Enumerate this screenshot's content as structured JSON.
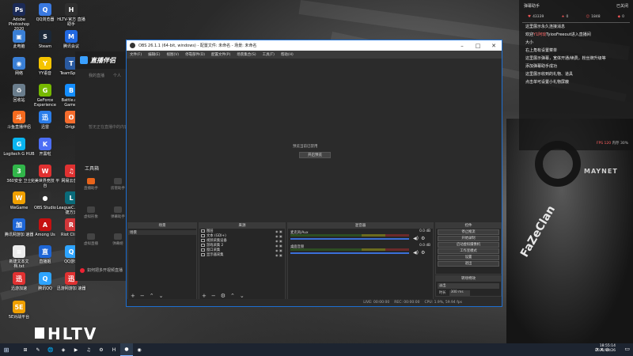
{
  "desktop": {
    "icons": [
      {
        "label": "Adobe\nPhotoshop 2020",
        "color": "#1b2a56",
        "glyph": "Ps"
      },
      {
        "label": "QQ浏览器",
        "color": "#3a79e0",
        "glyph": "Q"
      },
      {
        "label": "HLTV-官方\n直播助手",
        "color": "#2f2f2f",
        "glyph": "H"
      },
      {
        "label": "此电脑",
        "color": "#3a7fd5",
        "glyph": "▣"
      },
      {
        "label": "Steam",
        "color": "#1b2838",
        "glyph": "S"
      },
      {
        "label": "腾讯会议",
        "color": "#2168e0",
        "glyph": "M"
      },
      {
        "label": "网络",
        "color": "#3a7fd5",
        "glyph": "◉"
      },
      {
        "label": "YY语音",
        "color": "#f5c400",
        "glyph": "Y"
      },
      {
        "label": "TeamSpeak",
        "color": "#2a5aa0",
        "glyph": "T"
      },
      {
        "label": "回收站",
        "color": "#6a7d8c",
        "glyph": "♻"
      },
      {
        "label": "GeForce\nExperience",
        "color": "#76b900",
        "glyph": "G"
      },
      {
        "label": "Battle.net\nGames",
        "color": "#148eff",
        "glyph": "B"
      },
      {
        "label": "斗鱼直播伴侣",
        "color": "#f56b1f",
        "glyph": "斗"
      },
      {
        "label": "迅雷",
        "color": "#2b7de9",
        "glyph": "迅"
      },
      {
        "label": "Origin",
        "color": "#f56c2d",
        "glyph": "O"
      },
      {
        "label": "Logitech G\nHUB",
        "color": "#0ab5f0",
        "glyph": "G"
      },
      {
        "label": "开黑啦",
        "color": "#4c6ef5",
        "glyph": "K"
      },
      {
        "label": "",
        "color": "#2a2a2a",
        "glyph": ""
      },
      {
        "label": "360安全\n卫士",
        "color": "#31b64a",
        "glyph": "3"
      },
      {
        "label": "完美世界竞技\n平台",
        "color": "#e03131",
        "glyph": "W"
      },
      {
        "label": "网易云音乐",
        "color": "#e03131",
        "glyph": "♫"
      },
      {
        "label": "WeGame",
        "color": "#f0a000",
        "glyph": "W"
      },
      {
        "label": "OBS Studio",
        "color": "#2f2f2f",
        "glyph": "●"
      },
      {
        "label": "LeagueC...\n- 快捷方式",
        "color": "#0a6b7a",
        "glyph": "L"
      },
      {
        "label": "腾讯网游加\n速器",
        "color": "#1e66d6",
        "glyph": "加"
      },
      {
        "label": "Among Us",
        "color": "#c51111",
        "glyph": "A"
      },
      {
        "label": "Riot Client",
        "color": "#d13639",
        "glyph": "R"
      },
      {
        "label": "新建文本文\n档.txt",
        "color": "#ececec",
        "glyph": "≡"
      },
      {
        "label": "直播姬",
        "color": "#1e66d6",
        "glyph": "直"
      },
      {
        "label": "QQ游戏",
        "color": "#2ea4ff",
        "glyph": "Q"
      },
      {
        "label": "迅游加速",
        "color": "#e03131",
        "glyph": "迅"
      },
      {
        "label": "腾讯QQ",
        "color": "#2ea4ff",
        "glyph": "Q"
      },
      {
        "label": "迅游网游加\n速器",
        "color": "#e03131",
        "glyph": "迅"
      },
      {
        "label": "5E对战平台",
        "color": "#f0a000",
        "glyph": "5E"
      }
    ]
  },
  "helper": {
    "title": "直播伴侣",
    "tabs": [
      "我的直播",
      "个人"
    ],
    "empty_text": "暂无正在直播中的内容",
    "tools_header": "工具箱",
    "tools": [
      {
        "label": "直播助手",
        "color": "#e8641b"
      },
      {
        "label": "房管助手",
        "color": "#444"
      },
      {
        "label": "虚拟形象",
        "color": "#444"
      },
      {
        "label": "弹幕助手",
        "color": "#444"
      },
      {
        "label": "虚拟直播",
        "color": "#444"
      },
      {
        "label": "弹幕姬",
        "color": "#444"
      }
    ],
    "footer": "如何把多开视频直播"
  },
  "obs": {
    "title": "OBS 26.1.1 (64-bit, windows) - 配置文件: 未命名 - 场景: 未命名",
    "menu": [
      "文件(F)",
      "编辑(E)",
      "视图(V)",
      "停靠部件(D)",
      "配置文件(P)",
      "场景集合(S)",
      "工具(T)",
      "帮助(H)"
    ],
    "preview_message": "预览当前已禁用",
    "preview_button": "开启预览",
    "no_source": "未选择源",
    "settings_btn": "属性",
    "filters_btn": "滤镜",
    "docks": {
      "scenes": {
        "title": "场景",
        "items": [
          "场景"
        ]
      },
      "sources": {
        "title": "来源",
        "items": [
          "图层",
          "文本 (GDI+)",
          "视频采集设备",
          "游戏采集 2",
          "窗口采集",
          "显示器采集"
        ]
      },
      "mixer": {
        "title": "混音器",
        "channels": [
          {
            "name": "麦克风/Aux",
            "db": "0.0 dB"
          },
          {
            "name": "桌面音频",
            "db": "0.0 dB"
          }
        ]
      },
      "controls": {
        "title": "控件",
        "buttons": [
          "停止推流",
          "开始录制",
          "启动虚拟摄像机",
          "工作室模式",
          "设置",
          "退出"
        ]
      },
      "transition": {
        "title": "转场特效",
        "selected": "淡出",
        "duration_label": "时长",
        "duration_value": "300 ms"
      }
    },
    "status": {
      "live": "LIVE: 00:00:00",
      "rec": "REC: 00:00:00",
      "cpu": "CPU: 1.9%, 59.94 fps"
    }
  },
  "chat": {
    "title": "弹幕助手",
    "close_label": "已关闭",
    "stats": [
      {
        "icon": "♥",
        "value": "43339"
      },
      {
        "icon": "★",
        "value": "0"
      },
      {
        "icon": "☺",
        "value": "1848"
      },
      {
        "icon": "◆",
        "value": "0"
      }
    ],
    "lines": [
      {
        "text": "这里展示永久连接消息",
        "highlight": ""
      },
      {
        "text": "欢迎",
        "highlight": "Y1阿琰",
        "rest": "TyiooFreeout进入直播间"
      },
      {
        "text": "大小",
        "highlight": ""
      },
      {
        "text": "右上角有设置菜单",
        "highlight": ""
      },
      {
        "text": "这里展示弹幕，宽体开通/续费，粉丝牌升级等",
        "highlight": ""
      },
      {
        "text": "添加弹幕助手成功",
        "highlight": ""
      },
      {
        "text": "这里展示收到的礼物、道具",
        "highlight": ""
      },
      {
        "text": "点击单可设置小礼物屏蔽",
        "highlight": ""
      }
    ],
    "footer": {
      "fps": "FPS 120",
      "mem": "内存 30%"
    }
  },
  "taskbar": {
    "apps": [
      "⊞",
      "✎",
      "🌐",
      "◈",
      "▶",
      "♫",
      "⚙",
      "H",
      "●",
      "◉"
    ],
    "tray_text": "中",
    "time": "18:55:14",
    "date": "2021/10/26"
  },
  "wallpaper": {
    "logos": {
      "team": "MAYNET",
      "faze": "FaZeClan",
      "hltv": "HLTV"
    }
  }
}
